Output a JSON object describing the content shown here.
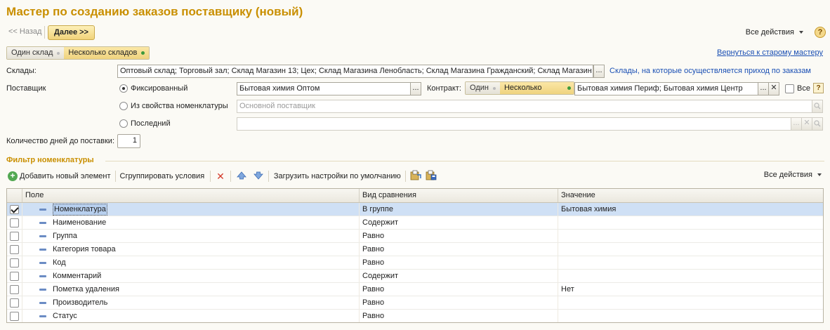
{
  "window": {
    "title": "Мастер по созданию заказов поставщику (новый)"
  },
  "nav": {
    "back_label": "<< Назад",
    "next_label": "Далее >>"
  },
  "top_actions": {
    "all_actions_label": "Все действия",
    "help_label": "?"
  },
  "warehouse_mode": {
    "single_label": "Один склад",
    "multi_label": "Несколько складов",
    "selected": "multi"
  },
  "old_wizard_link": "Вернуться к старому мастеру",
  "warehouses": {
    "label": "Склады:",
    "value": "Оптовый склад; Торговый зал; Склад Магазин 13; Цех; Склад Магазина Ленобласть; Склад Магазина Гражданский; Склад Магазин",
    "choose_btn": "...",
    "hint": "Склады, на которые осуществляется приход по заказам"
  },
  "supplier": {
    "label": "Поставщик",
    "option_fixed": "Фиксированный",
    "option_property": "Из свойства номенклатуры",
    "option_last": "Последний",
    "selected": "fixed",
    "fixed_value": "Бытовая химия Оптом",
    "property_placeholder": "Основной поставщик",
    "last_value": "",
    "contract_label": "Контракт:",
    "contract_single": "Один",
    "contract_multi": "Несколько",
    "contract_value": "Бытовая химия Периф; Бытовая химия Центр",
    "all_label": "Все",
    "choose_btn": "...",
    "clear_btn": "✕",
    "search_btn": "🔍",
    "help": "?"
  },
  "delivery_days": {
    "label": "Количество дней до поставки:",
    "value": "1"
  },
  "filter": {
    "section_title": "Фильтр номенклатуры",
    "toolbar": {
      "add_label": "Добавить новый элемент",
      "group_label": "Сгруппировать условия",
      "load_defaults_label": "Загрузить настройки по умолчанию",
      "all_actions_label": "Все действия"
    },
    "columns": {
      "field": "Поле",
      "comparison": "Вид сравнения",
      "value": "Значение"
    },
    "rows": [
      {
        "checked": true,
        "field": "Номенклатура",
        "comparison": "В группе",
        "value": "Бытовая химия"
      },
      {
        "checked": false,
        "field": "Наименование",
        "comparison": "Содержит",
        "value": ""
      },
      {
        "checked": false,
        "field": "Группа",
        "comparison": "Равно",
        "value": ""
      },
      {
        "checked": false,
        "field": "Категория товара",
        "comparison": "Равно",
        "value": ""
      },
      {
        "checked": false,
        "field": "Код",
        "comparison": "Равно",
        "value": ""
      },
      {
        "checked": false,
        "field": "Комментарий",
        "comparison": "Содержит",
        "value": ""
      },
      {
        "checked": false,
        "field": "Пометка удаления",
        "comparison": "Равно",
        "value": "Нет"
      },
      {
        "checked": false,
        "field": "Производитель",
        "comparison": "Равно",
        "value": ""
      },
      {
        "checked": false,
        "field": "Статус",
        "comparison": "Равно",
        "value": ""
      }
    ]
  },
  "colors": {
    "title": "#c98f00",
    "link": "#1a4fb4",
    "selected_row": "#cfe0f5",
    "active_segment": "#efd37e"
  }
}
